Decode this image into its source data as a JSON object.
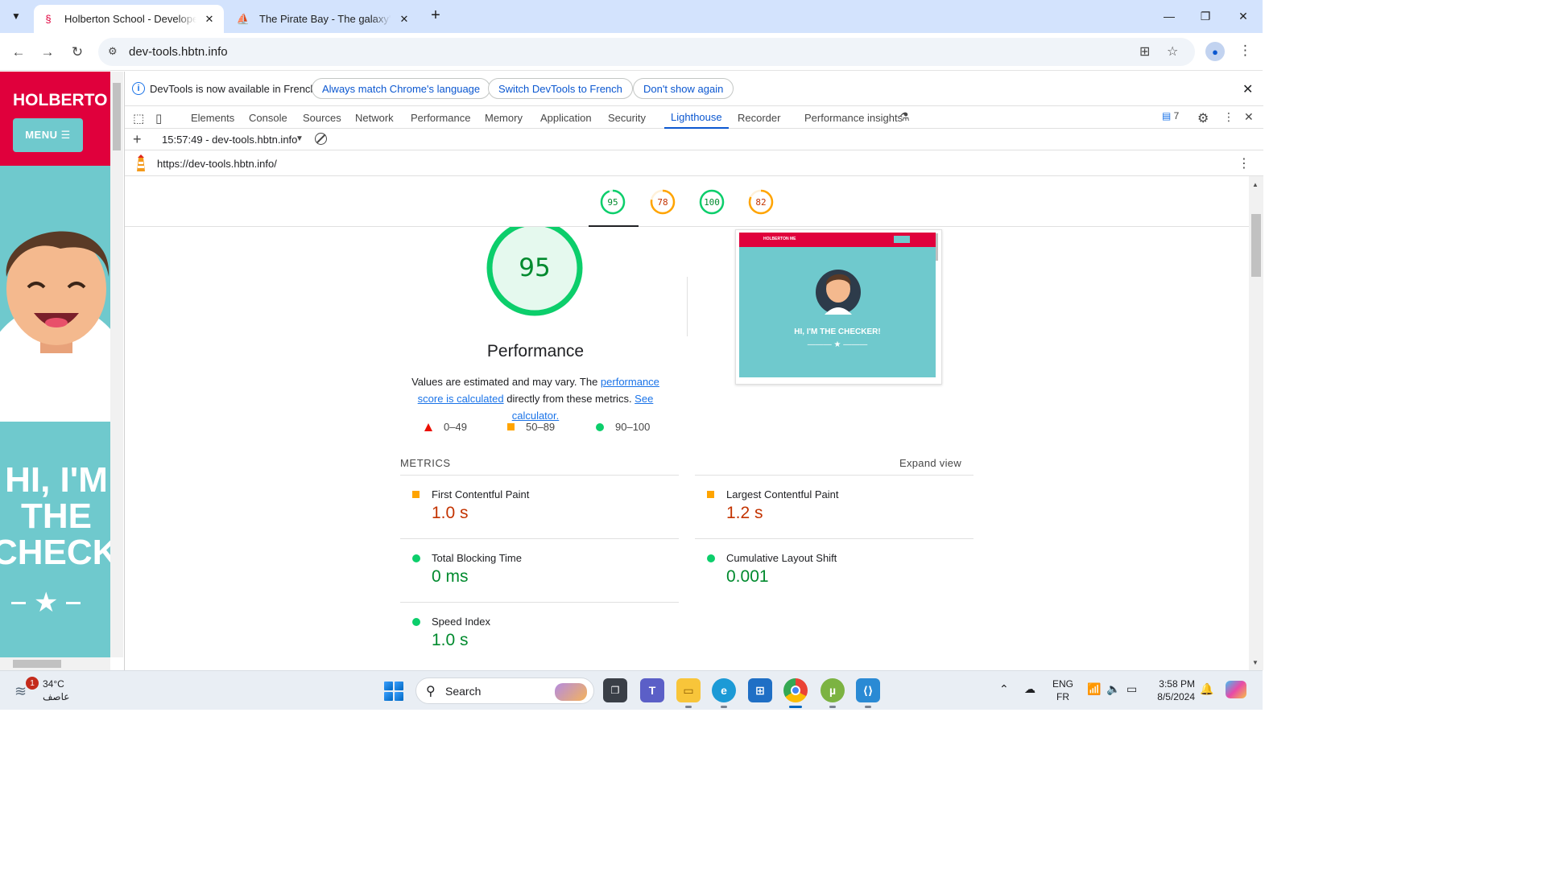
{
  "browser": {
    "tabs": [
      {
        "title": "Holberton School - Developer tools",
        "favicon": "holberton-seahorse-icon",
        "active": true
      },
      {
        "title": "The Pirate Bay - The galaxy's most resilient",
        "favicon": "pirate-ship-icon",
        "active": false
      }
    ],
    "url": "dev-tools.hbtn.info"
  },
  "page": {
    "brand": "HOLBERTO",
    "menu_label": "MENU ☰",
    "hero": "HI, I'M THE CHECKE"
  },
  "devtools": {
    "infobar": {
      "message": "DevTools is now available in French!",
      "btn_match": "Always match Chrome's language",
      "btn_switch": "Switch DevTools to French",
      "btn_dont": "Don't show again"
    },
    "tabs": [
      "Elements",
      "Console",
      "Sources",
      "Network",
      "Performance",
      "Memory",
      "Application",
      "Security",
      "Lighthouse",
      "Recorder",
      "Performance insights"
    ],
    "active_tab": "Lighthouse",
    "issues_count": "7",
    "lighthouse": {
      "report_label": "15:57:49 - dev-tools.hbtn.info",
      "audited_url": "https://dev-tools.hbtn.info/",
      "category_scores": [
        {
          "score": "95",
          "color": "#0cce6b",
          "text_color": "#008a2e"
        },
        {
          "score": "78",
          "color": "#ffa400",
          "text_color": "#c33300"
        },
        {
          "score": "100",
          "color": "#0cce6b",
          "text_color": "#008a2e"
        },
        {
          "score": "82",
          "color": "#ffa400",
          "text_color": "#c33300"
        }
      ],
      "performance": {
        "score": "95",
        "title": "Performance",
        "desc_prefix": "Values are estimated and may vary. The ",
        "desc_link1": "performance score is calculated",
        "desc_mid": " directly from these metrics. ",
        "desc_link2": "See calculator.",
        "legend": [
          {
            "range": "0–49",
            "shape": "triangle",
            "color": "#eb0f00"
          },
          {
            "range": "50–89",
            "shape": "square",
            "color": "#ffa400"
          },
          {
            "range": "90–100",
            "shape": "circle",
            "color": "#0cce6b"
          }
        ]
      },
      "screenshot": {
        "brand": "HOLBERTON ME",
        "hero": "HI, I'M THE CHECKER!"
      },
      "metrics_label": "METRICS",
      "expand_label": "Expand view",
      "metrics": [
        {
          "name": "First Contentful Paint",
          "value": "1.0 s",
          "status": "average"
        },
        {
          "name": "Largest Contentful Paint",
          "value": "1.2 s",
          "status": "average"
        },
        {
          "name": "Total Blocking Time",
          "value": "0 ms",
          "status": "pass"
        },
        {
          "name": "Cumulative Layout Shift",
          "value": "0.001",
          "status": "pass"
        },
        {
          "name": "Speed Index",
          "value": "1.0 s",
          "status": "pass"
        }
      ]
    }
  },
  "taskbar": {
    "temperature": "34°C",
    "condition": "عاصف",
    "weather_badge": "1",
    "search_label": "Search",
    "lang_primary": "ENG",
    "lang_secondary": "FR",
    "time": "3:58 PM",
    "date": "8/5/2024"
  },
  "colors": {
    "accent": "#0b57d0",
    "pass": "#0cce6b",
    "average": "#ffa400",
    "fail": "#eb0f00",
    "holberton_red": "#e0003c",
    "holberton_teal": "#6fc9cd"
  }
}
